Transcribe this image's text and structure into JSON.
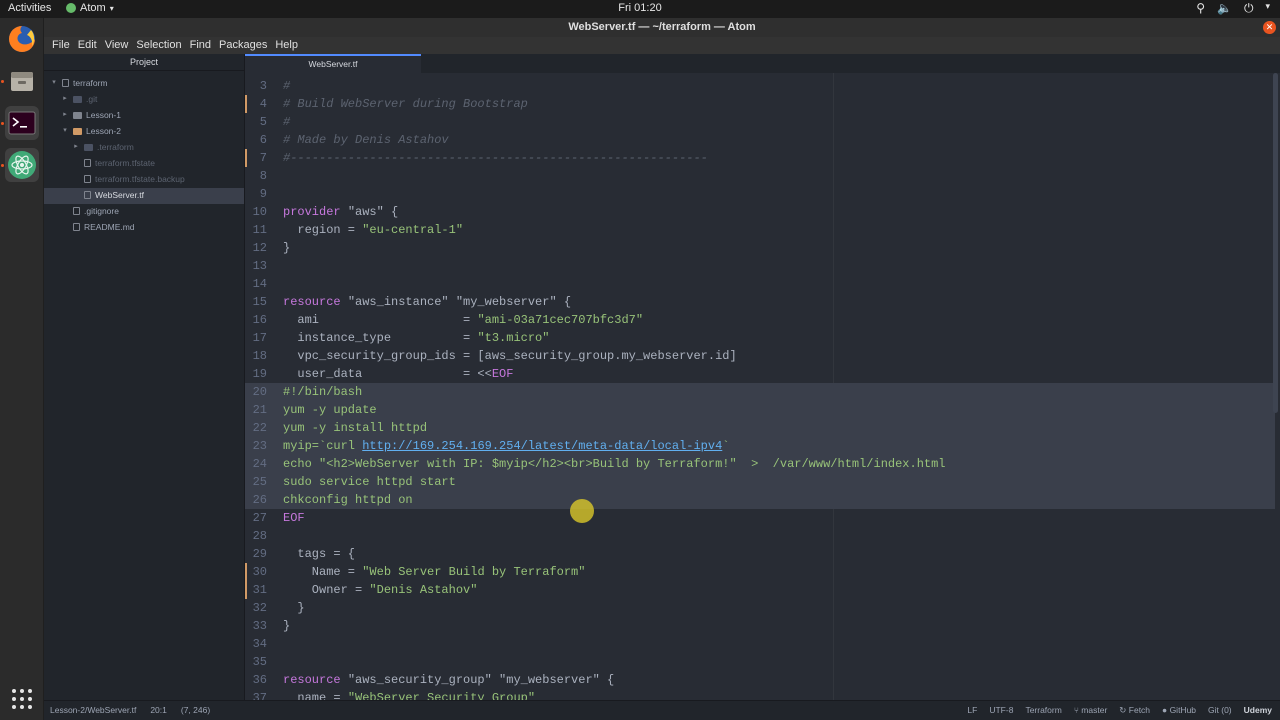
{
  "topbar": {
    "activities": "Activities",
    "app_name": "Atom",
    "clock": "Fri 01:20"
  },
  "dock": {
    "apps": [
      "firefox-icon",
      "files-icon",
      "terminal-icon",
      "atom-icon"
    ]
  },
  "window": {
    "title": "WebServer.tf — ~/terraform — Atom"
  },
  "menu": [
    "File",
    "Edit",
    "View",
    "Selection",
    "Find",
    "Packages",
    "Help"
  ],
  "tree": {
    "header": "Project",
    "items": [
      {
        "label": "terraform",
        "depth": 0,
        "kind": "root",
        "expanded": true
      },
      {
        "label": ".git",
        "depth": 1,
        "kind": "folder",
        "expanded": false,
        "dim": true
      },
      {
        "label": "Lesson-1",
        "depth": 1,
        "kind": "folder",
        "expanded": false
      },
      {
        "label": "Lesson-2",
        "depth": 1,
        "kind": "folder",
        "expanded": true
      },
      {
        "label": ".terraform",
        "depth": 2,
        "kind": "folder",
        "expanded": false,
        "dim": true
      },
      {
        "label": "terraform.tfstate",
        "depth": 2,
        "kind": "file",
        "dim": true
      },
      {
        "label": "terraform.tfstate.backup",
        "depth": 2,
        "kind": "file",
        "dim": true
      },
      {
        "label": "WebServer.tf",
        "depth": 2,
        "kind": "file",
        "selected": true
      },
      {
        "label": ".gitignore",
        "depth": 1,
        "kind": "file"
      },
      {
        "label": "README.md",
        "depth": 1,
        "kind": "file"
      }
    ]
  },
  "tab": {
    "label": "WebServer.tf"
  },
  "code": [
    {
      "n": "3",
      "t": [
        [
          "#",
          "com"
        ]
      ]
    },
    {
      "n": "4",
      "t": [
        [
          "# Build WebServer during Bootstrap",
          "com"
        ]
      ]
    },
    {
      "n": "5",
      "t": [
        [
          "#",
          "com"
        ]
      ]
    },
    {
      "n": "6",
      "t": [
        [
          "# Made by Denis Astahov",
          "com"
        ]
      ]
    },
    {
      "n": "7",
      "t": [
        [
          "#----------------------------------------------------------",
          "com"
        ]
      ]
    },
    {
      "n": "8",
      "t": []
    },
    {
      "n": "9",
      "t": []
    },
    {
      "n": "10",
      "t": [
        [
          "provider ",
          "kw"
        ],
        [
          "\"aws\"",
          "plain"
        ],
        [
          " {",
          "plain"
        ]
      ]
    },
    {
      "n": "11",
      "t": [
        [
          "  region = ",
          "plain"
        ],
        [
          "\"eu-central-1\"",
          "str"
        ]
      ]
    },
    {
      "n": "12",
      "t": [
        [
          "}",
          "plain"
        ]
      ]
    },
    {
      "n": "13",
      "t": []
    },
    {
      "n": "14",
      "t": []
    },
    {
      "n": "15",
      "t": [
        [
          "resource ",
          "kw"
        ],
        [
          "\"aws_instance\" \"my_webserver\"",
          "plain"
        ],
        [
          " {",
          "plain"
        ]
      ]
    },
    {
      "n": "16",
      "t": [
        [
          "  ami                    = ",
          "plain"
        ],
        [
          "\"ami-03a71cec707bfc3d7\"",
          "str"
        ]
      ]
    },
    {
      "n": "17",
      "t": [
        [
          "  instance_type          = ",
          "plain"
        ],
        [
          "\"t3.micro\"",
          "str"
        ]
      ]
    },
    {
      "n": "18",
      "t": [
        [
          "  vpc_security_group_ids = [aws_security_group.my_webserver.id]",
          "plain"
        ]
      ]
    },
    {
      "n": "19",
      "t": [
        [
          "  user_data              = <<",
          "plain"
        ],
        [
          "EOF",
          "kw"
        ]
      ]
    },
    {
      "n": "20",
      "t": [
        [
          "#!/bin/bash",
          "str"
        ]
      ]
    },
    {
      "n": "21",
      "t": [
        [
          "yum -y update",
          "str"
        ]
      ]
    },
    {
      "n": "22",
      "t": [
        [
          "yum -y install httpd",
          "str"
        ]
      ]
    },
    {
      "n": "23",
      "t": [
        [
          "myip=`curl ",
          "str"
        ],
        [
          "http://169.254.169.254/latest/meta-data/local-ipv4",
          "url"
        ],
        [
          "`",
          "str"
        ]
      ]
    },
    {
      "n": "24",
      "t": [
        [
          "echo \"<h2>WebServer with IP: $myip</h2><br>Build by Terraform!\"  >  /var/www/html/index.html",
          "str"
        ]
      ]
    },
    {
      "n": "25",
      "t": [
        [
          "sudo service httpd start",
          "str"
        ]
      ]
    },
    {
      "n": "26",
      "t": [
        [
          "chkconfig httpd on",
          "str"
        ]
      ]
    },
    {
      "n": "27",
      "t": [
        [
          "EOF",
          "kw"
        ]
      ]
    },
    {
      "n": "28",
      "t": []
    },
    {
      "n": "29",
      "t": [
        [
          "  tags = {",
          "plain"
        ]
      ]
    },
    {
      "n": "30",
      "t": [
        [
          "    Name = ",
          "plain"
        ],
        [
          "\"Web Server Build by Terraform\"",
          "str"
        ]
      ]
    },
    {
      "n": "31",
      "t": [
        [
          "    Owner = ",
          "plain"
        ],
        [
          "\"Denis Astahov\"",
          "str"
        ]
      ]
    },
    {
      "n": "32",
      "t": [
        [
          "  }",
          "plain"
        ]
      ]
    },
    {
      "n": "33",
      "t": [
        [
          "}",
          "plain"
        ]
      ]
    },
    {
      "n": "34",
      "t": []
    },
    {
      "n": "35",
      "t": []
    },
    {
      "n": "36",
      "t": [
        [
          "resource ",
          "kw"
        ],
        [
          "\"aws_security_group\" \"my_webserver\"",
          "plain"
        ],
        [
          " {",
          "plain"
        ]
      ]
    },
    {
      "n": "37",
      "t": [
        [
          "  name = ",
          "plain"
        ],
        [
          "\"WebServer Security Group\"",
          "str"
        ]
      ]
    }
  ],
  "status": {
    "path": "Lesson-2/WebServer.tf",
    "cursor": "20:1",
    "selection": "(7, 246)",
    "line_ending": "LF",
    "encoding": "UTF-8",
    "grammar": "Terraform",
    "branch": "master",
    "fetch": "Fetch",
    "github": "GitHub",
    "git": "Git (0)"
  },
  "watermark": "Udemy"
}
